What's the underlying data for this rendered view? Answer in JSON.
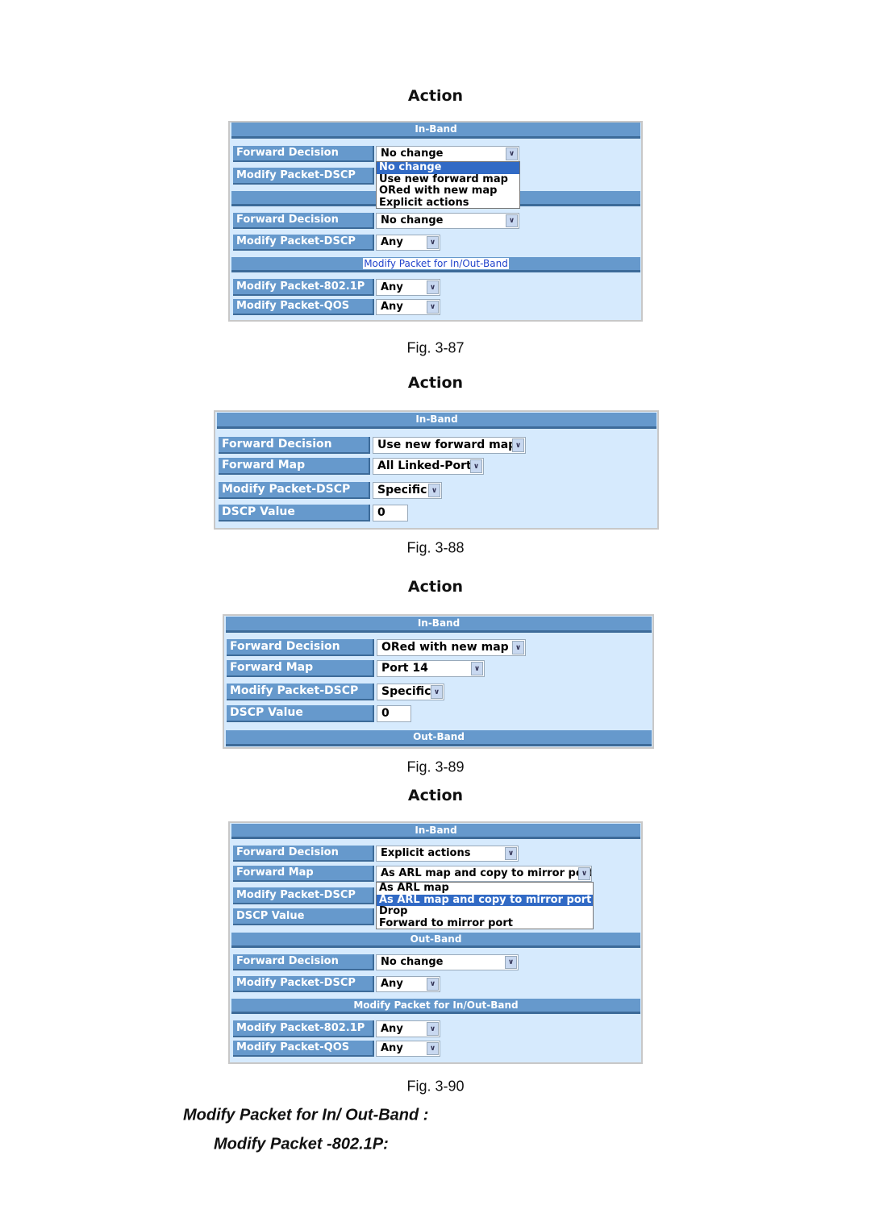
{
  "figures": [
    {
      "title": "Action",
      "caption": "Fig. 3-87",
      "rows": [
        {
          "type": "header",
          "text": "In-Band"
        },
        {
          "type": "field",
          "label": "Forward Decision",
          "value": "No change"
        },
        {
          "type": "field",
          "label": "Modify Packet-DSCP",
          "value": null
        },
        {
          "type": "header",
          "text": ""
        },
        {
          "type": "field",
          "label": "Forward Decision",
          "value": "No change"
        },
        {
          "type": "field",
          "label": "Modify Packet-DSCP",
          "value": "Any"
        },
        {
          "type": "header",
          "text": "Modify Packet for In/Out-Band",
          "selected": true
        },
        {
          "type": "field",
          "label": "Modify Packet-802.1P",
          "value": "Any"
        },
        {
          "type": "field",
          "label": "Modify Packet-QOS",
          "value": "Any"
        }
      ],
      "dropdown": {
        "options": [
          "No change",
          "Use new forward map",
          "ORed with new map",
          "Explicit actions"
        ],
        "highlighted": 0
      }
    },
    {
      "title": "Action",
      "caption": "Fig. 3-88",
      "rows": [
        {
          "type": "header",
          "text": "In-Band"
        },
        {
          "type": "field",
          "label": "Forward Decision",
          "value": "Use new forward map"
        },
        {
          "type": "field",
          "label": "Forward Map",
          "value": "All Linked-Port"
        },
        {
          "type": "field",
          "label": "Modify Packet-DSCP",
          "value": "Specific"
        },
        {
          "type": "field",
          "label": "DSCP Value",
          "value": "0",
          "input": true
        }
      ]
    },
    {
      "title": "Action",
      "caption": "Fig. 3-89",
      "rows": [
        {
          "type": "header",
          "text": "In-Band"
        },
        {
          "type": "field",
          "label": "Forward Decision",
          "value": "ORed with new map"
        },
        {
          "type": "field",
          "label": "Forward Map",
          "value": "Port 14"
        },
        {
          "type": "field",
          "label": "Modify Packet-DSCP",
          "value": "Specific"
        },
        {
          "type": "field",
          "label": "DSCP Value",
          "value": "0",
          "input": true
        },
        {
          "type": "header",
          "text": "Out-Band"
        }
      ]
    },
    {
      "title": "Action",
      "caption": "Fig. 3-90",
      "rows": [
        {
          "type": "header",
          "text": "In-Band"
        },
        {
          "type": "field",
          "label": "Forward Decision",
          "value": "Explicit actions"
        },
        {
          "type": "field",
          "label": "Forward Map",
          "value": "As ARL map and copy to mirror port"
        },
        {
          "type": "field",
          "label": "Modify Packet-DSCP",
          "value": null
        },
        {
          "type": "field",
          "label": "DSCP Value",
          "value": null
        },
        {
          "type": "header",
          "text": "Out-Band"
        },
        {
          "type": "field",
          "label": "Forward Decision",
          "value": "No change"
        },
        {
          "type": "field",
          "label": "Modify Packet-DSCP",
          "value": "Any"
        },
        {
          "type": "header",
          "text": "Modify Packet for In/Out-Band"
        },
        {
          "type": "field",
          "label": "Modify Packet-802.1P",
          "value": "Any"
        },
        {
          "type": "field",
          "label": "Modify Packet-QOS",
          "value": "Any"
        }
      ],
      "dropdown": {
        "options": [
          "As ARL map",
          "As ARL map and copy to mirror port",
          "Drop",
          "Forward to mirror port"
        ],
        "highlighted": 1
      }
    }
  ],
  "notes": {
    "heading": "Modify Packet for In/ Out-Band :",
    "subheading": "Modify Packet -802.1P:"
  }
}
